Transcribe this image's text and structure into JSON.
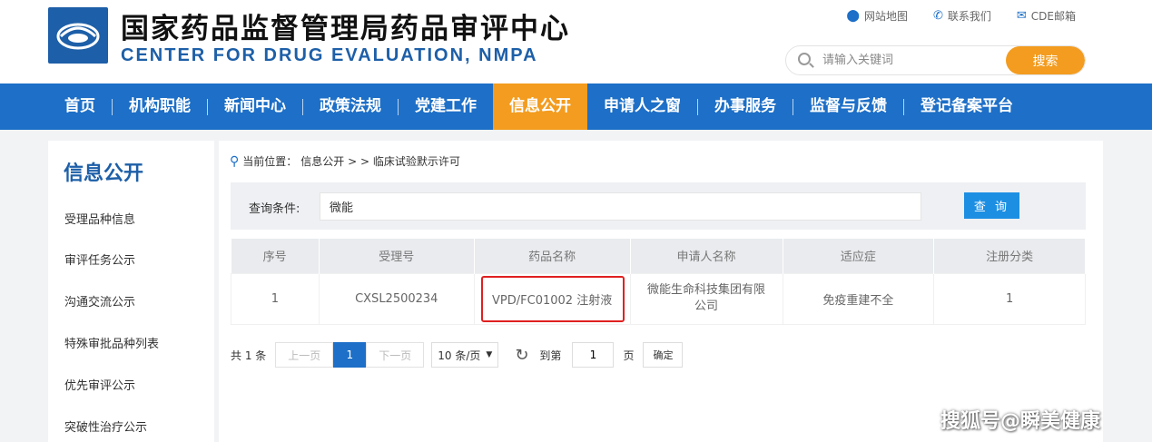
{
  "header": {
    "title_cn": "国家药品监督管理局药品审评中心",
    "title_en": "CENTER FOR DRUG EVALUATION, NMPA",
    "links": [
      {
        "label": "网站地图",
        "icon": "location-pin-icon"
      },
      {
        "label": "联系我们",
        "icon": "phone-icon"
      },
      {
        "label": "CDE邮箱",
        "icon": "mail-icon"
      }
    ],
    "search_placeholder": "请输入关键词",
    "search_button": "搜索"
  },
  "nav": {
    "items": [
      "首页",
      "机构职能",
      "新闻中心",
      "政策法规",
      "党建工作",
      "信息公开",
      "申请人之窗",
      "办事服务",
      "监督与反馈",
      "登记备案平台"
    ],
    "active": "信息公开"
  },
  "sidebar": {
    "title": "信息公开",
    "items": [
      "受理品种信息",
      "审评任务公示",
      "沟通交流公示",
      "特殊审批品种列表",
      "优先审评公示",
      "突破性治疗公示"
    ]
  },
  "breadcrumb": {
    "prefix": "当前位置：",
    "path": "信息公开 > > 临床试验默示许可"
  },
  "query": {
    "label": "查询条件:",
    "value": "微能",
    "button": "查 询"
  },
  "table": {
    "headers": [
      "序号",
      "受理号",
      "药品名称",
      "申请人名称",
      "适应症",
      "注册分类"
    ],
    "rows": [
      [
        "1",
        "CXSL2500234",
        "VPD/FC01002 注射液",
        "微能生命科技集团有限公司",
        "免疫重建不全",
        "1"
      ]
    ]
  },
  "pager": {
    "total": "共 1 条",
    "prev": "上一页",
    "current": "1",
    "next": "下一页",
    "page_size": "10 条/页",
    "goto_label": "到第",
    "goto_value": "1",
    "page_suffix": "页",
    "confirm": "确定"
  },
  "watermark": "搜狐号@瞬美健康",
  "colors": {
    "brand_blue": "#1d6fc7",
    "accent_orange": "#f39c1f",
    "highlight_red": "#e02020"
  }
}
